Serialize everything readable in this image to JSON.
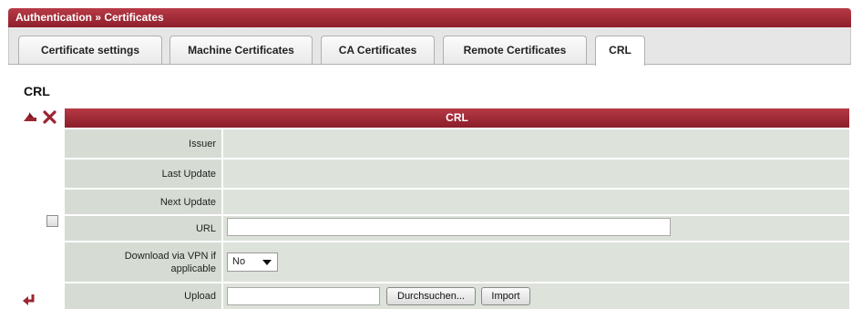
{
  "header": {
    "title": "Authentication » Certificates"
  },
  "tabs": [
    {
      "label": "Certificate settings"
    },
    {
      "label": "Machine Certificates"
    },
    {
      "label": "CA Certificates"
    },
    {
      "label": "Remote Certificates"
    },
    {
      "label": "CRL",
      "active": true
    }
  ],
  "section": {
    "title": "CRL"
  },
  "table": {
    "header": "CRL",
    "rows": {
      "issuer": {
        "label": "Issuer",
        "value": ""
      },
      "last_update": {
        "label": "Last Update",
        "value": ""
      },
      "next_update": {
        "label": "Next Update",
        "value": ""
      },
      "url": {
        "label": "URL",
        "value": ""
      },
      "download_vpn": {
        "label": "Download via VPN if applicable",
        "selected": "No"
      },
      "upload": {
        "label": "Upload",
        "value": "",
        "browse_label": "Durchsuchen...",
        "import_label": "Import"
      }
    }
  },
  "colors": {
    "accent": "#9b2633",
    "label_bg": "#d6dcd3",
    "value_bg": "#dde2da",
    "tab_strip": "#e6e6e6"
  },
  "icons": {
    "save": "save-arrow-icon",
    "delete": "delete-x-icon",
    "return": "return-arrow-icon",
    "dropdown": "chevron-down-icon"
  }
}
